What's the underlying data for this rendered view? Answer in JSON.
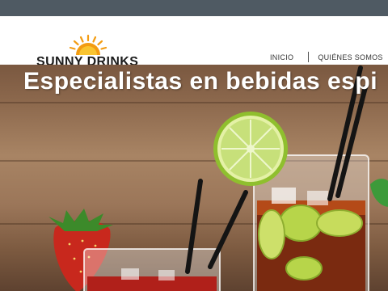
{
  "brand": {
    "name": "SUNNY DRINKS"
  },
  "nav": {
    "items": [
      {
        "label": "INICIO"
      },
      {
        "label": "QUIÉNES SOMOS"
      }
    ]
  },
  "hero": {
    "title": "Especialistas en bebidas espi"
  },
  "colors": {
    "topbar": "#4f5a63",
    "sun_orange": "#f39c12",
    "sun_yellow": "#f9c430"
  }
}
